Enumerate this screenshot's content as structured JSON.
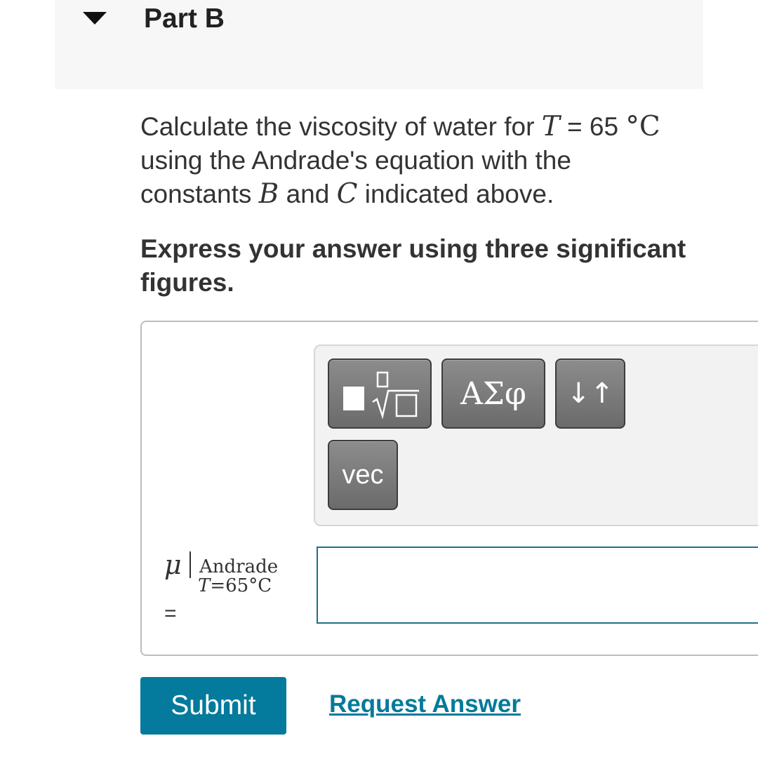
{
  "part": {
    "title": "Part B"
  },
  "question": {
    "line1_prefix": "Calculate the viscosity of water for ",
    "var_T": "T",
    "equals_value": " = 65 ",
    "unit_degC": "°C",
    "line2": "using the Andrade's equation with the",
    "line3_prefix": "constants ",
    "var_B": "B",
    "and_text": " and ",
    "var_C": "C",
    "line3_suffix": " indicated above."
  },
  "instruction": "Express your answer using three significant figures.",
  "toolbar": {
    "templates_icon": "template-sqrt-icon",
    "greek_label": "ΑΣφ",
    "arrows_label": "↓↑",
    "vec_label": "vec"
  },
  "answer": {
    "symbol": "μ",
    "subscript_top": "Andrade",
    "subscript_T": "T",
    "subscript_rest": "=65°C",
    "equals": "=",
    "value": ""
  },
  "actions": {
    "submit_label": "Submit",
    "request_label": "Request Answer"
  },
  "colors": {
    "accent": "#047a9c",
    "input_border": "#1f6f8b",
    "header_bg": "#f7f7f7",
    "tool_button": "#7a7a7a"
  }
}
